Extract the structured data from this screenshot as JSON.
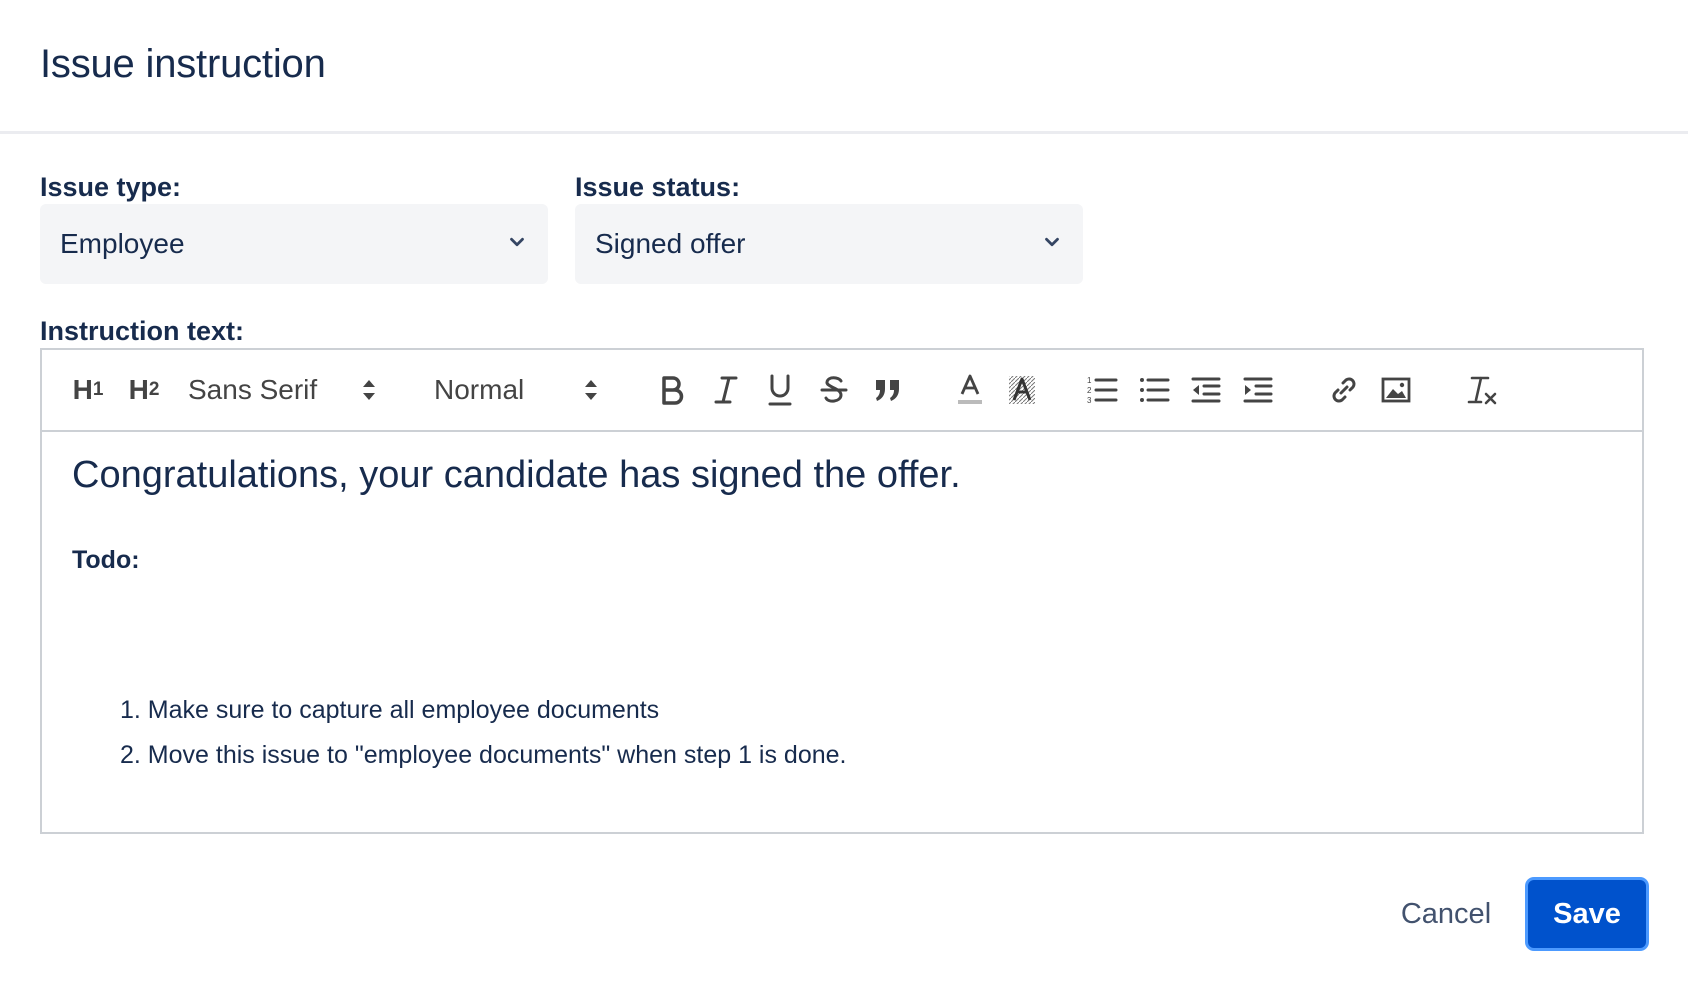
{
  "dialog": {
    "title": "Issue instruction"
  },
  "issue_type": {
    "label": "Issue type:",
    "value": "Employee"
  },
  "issue_status": {
    "label": "Issue status:",
    "value": "Signed offer"
  },
  "instruction": {
    "label": "Instruction text:"
  },
  "toolbar": {
    "h1": "H",
    "h1_sub": "1",
    "h2": "H",
    "h2_sub": "2",
    "font": "Sans Serif",
    "size": "Normal",
    "buttons": [
      "bold-icon",
      "italic-icon",
      "underline-icon",
      "strike-icon",
      "blockquote-icon",
      "text-color-icon",
      "background-color-icon",
      "ordered-list-icon",
      "bullet-list-icon",
      "outdent-icon",
      "indent-icon",
      "link-icon",
      "image-icon",
      "clear-format-icon"
    ]
  },
  "editor": {
    "heading": "Congratulations, your candidate has signed the offer.",
    "todo": "Todo:",
    "items": [
      "1. Make sure to capture all employee documents",
      "2. Move this issue to \"employee documents\" when step 1 is done."
    ]
  },
  "actions": {
    "cancel": "Cancel",
    "save": "Save"
  },
  "colors": {
    "primary": "#0052cc",
    "focus_ring": "#4c9aff",
    "text": "#172b4d",
    "select_bg": "#f4f5f7"
  }
}
